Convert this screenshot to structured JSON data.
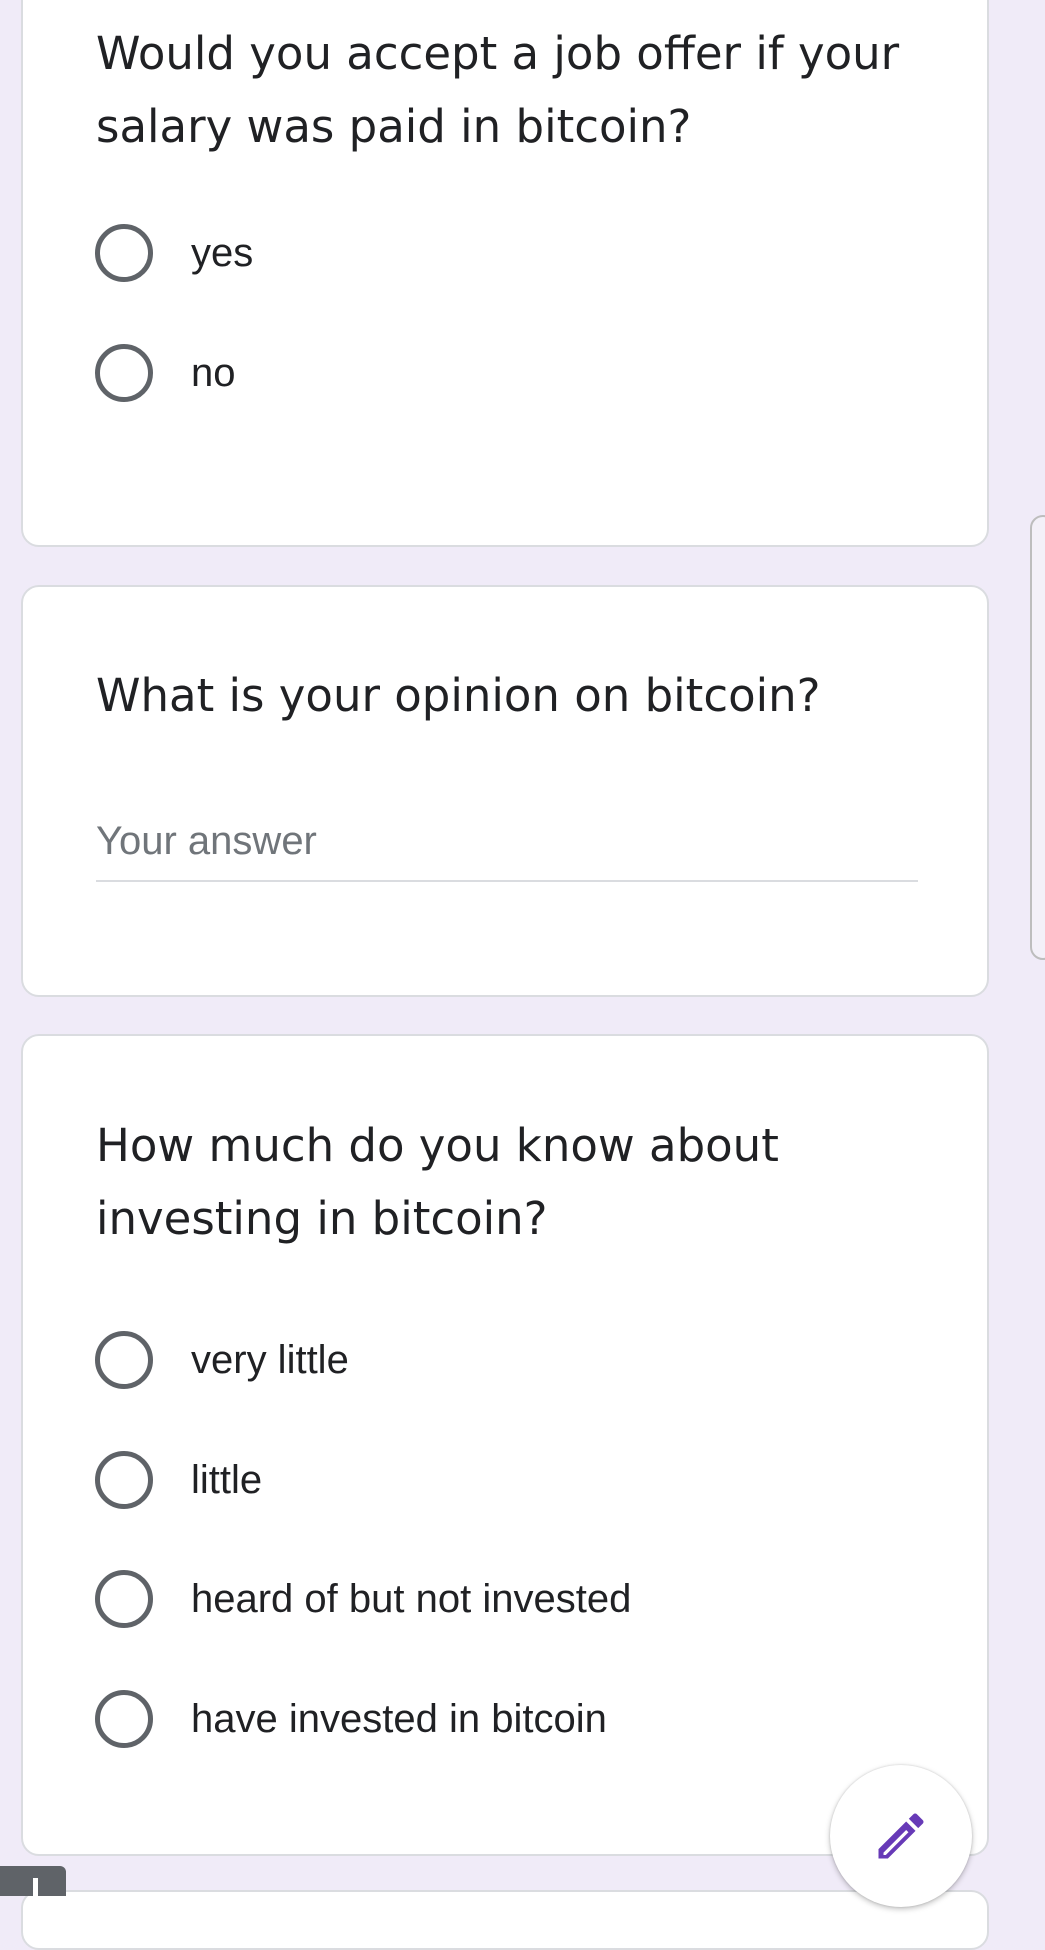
{
  "questions": [
    {
      "title": "Would you accept a job offer if your salary was paid in bitcoin?",
      "type": "multiple-choice",
      "options": [
        "yes",
        "no"
      ]
    },
    {
      "title": "What is your opinion on bitcoin?",
      "type": "short-answer",
      "placeholder": "Your answer",
      "value": ""
    },
    {
      "title": "How much do you know about investing in bitcoin?",
      "type": "multiple-choice",
      "options": [
        "very little",
        "little",
        "heard of but not invested",
        "have invested in bitcoin"
      ]
    }
  ],
  "fab": {
    "icon": "pencil-icon"
  },
  "colors": {
    "background": "#f0ebf8",
    "card": "#ffffff",
    "accent": "#673ab7",
    "radio_border": "#5f6368",
    "text": "#202124",
    "placeholder": "#70757a"
  }
}
